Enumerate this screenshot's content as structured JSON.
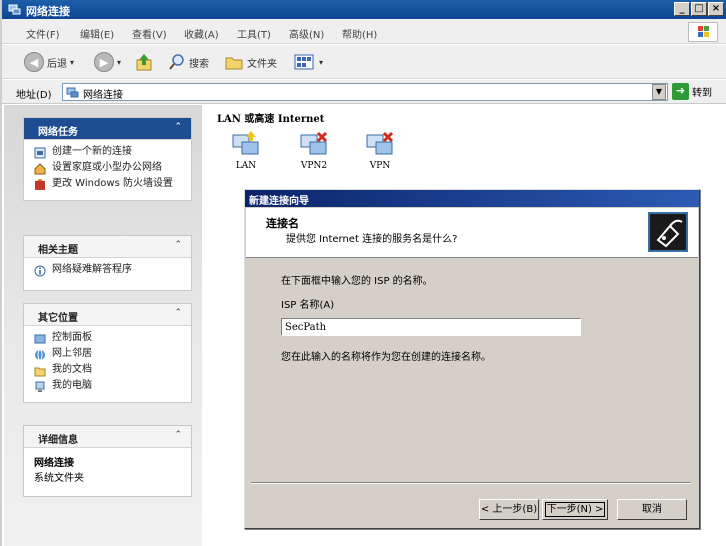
{
  "window": {
    "title": "网络连接",
    "caption_buttons": [
      "_",
      "□",
      "×"
    ]
  },
  "menu": [
    "文件(F)",
    "编辑(E)",
    "查看(V)",
    "收藏(A)",
    "工具(T)",
    "高级(N)",
    "帮助(H)"
  ],
  "toolbar": {
    "back_label": "后退",
    "search_label": "搜索",
    "folders_label": "文件夹"
  },
  "address": {
    "label": "地址(D)",
    "value": "网络连接",
    "go_label": "转到"
  },
  "sidebar": {
    "network_tasks": {
      "title": "网络任务",
      "items": [
        {
          "label": "创建一个新的连接",
          "icon": "new-connection-icon"
        },
        {
          "label": "设置家庭或小型办公网络",
          "icon": "home-network-icon"
        },
        {
          "label": "更改 Windows 防火墙设置",
          "icon": "firewall-icon"
        }
      ]
    },
    "related": {
      "title": "相关主题",
      "items": [
        {
          "label": "网络疑难解答程序",
          "icon": "info-icon"
        }
      ]
    },
    "other_places": {
      "title": "其它位置",
      "items": [
        {
          "label": "控制面板",
          "icon": "control-panel-icon"
        },
        {
          "label": "网上邻居",
          "icon": "network-places-icon"
        },
        {
          "label": "我的文档",
          "icon": "my-documents-icon"
        },
        {
          "label": "我的电脑",
          "icon": "my-computer-icon"
        }
      ]
    },
    "details": {
      "title": "详细信息",
      "name": "网络连接",
      "type": "系统文件夹"
    }
  },
  "content": {
    "group_heading": "LAN 或高速 Internet",
    "connections": [
      {
        "label": "LAN",
        "status": "ok"
      },
      {
        "label": "VPN2",
        "status": "disconnected"
      },
      {
        "label": "VPN",
        "status": "disconnected"
      }
    ]
  },
  "wizard": {
    "title": "新建连接向导",
    "header_title": "连接名",
    "header_subtitle": "提供您 Internet 连接的服务名是什么?",
    "instruction": "在下面框中输入您的 ISP 的名称。",
    "field_label": "ISP 名称(A)",
    "field_value": "SecPath",
    "note": "您在此输入的名称将作为您在创建的连接名称。",
    "buttons": {
      "back": "< 上一步(B)",
      "next": "下一步(N) >",
      "cancel": "取消"
    }
  },
  "colors": {
    "titlebar": "#0e4593",
    "task_header_dark": "#1f4d91",
    "wizard_title": "#0a246a"
  }
}
